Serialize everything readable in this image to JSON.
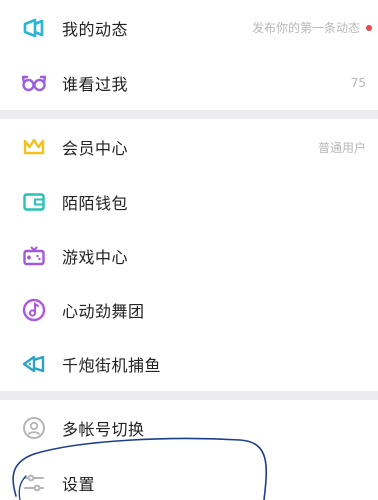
{
  "menu": {
    "group1": [
      {
        "label": "我的动态",
        "value": "发布你的第一条动态",
        "icon": "megaphone-icon",
        "has_dot": true
      },
      {
        "label": "谁看过我",
        "value": "75",
        "icon": "glasses-icon"
      }
    ],
    "group2": [
      {
        "label": "会员中心",
        "value": "普通用户",
        "icon": "crown-icon"
      },
      {
        "label": "陌陌钱包",
        "value": "",
        "icon": "wallet-icon"
      },
      {
        "label": "游戏中心",
        "value": "",
        "icon": "gamepad-icon"
      },
      {
        "label": "心动劲舞团",
        "value": "",
        "icon": "music-note-icon"
      },
      {
        "label": "千炮街机捕鱼",
        "value": "",
        "icon": "fish-icon"
      }
    ],
    "group3": [
      {
        "label": "多帐号切换",
        "value": "",
        "icon": "account-switch-icon"
      },
      {
        "label": "设置",
        "value": "",
        "icon": "settings-sliders-icon"
      }
    ]
  },
  "colors": {
    "megaphone": "#2ab4d6",
    "glasses": "#9b5fe0",
    "crown": "#f2c21b",
    "wallet": "#26c2b4",
    "gamepad": "#a259d9",
    "music": "#b057e0",
    "fish": "#2aa3c8",
    "gray_icon": "#b5b5b5",
    "red_dot": "#e8474a",
    "annotation": "#1d3f8c"
  }
}
